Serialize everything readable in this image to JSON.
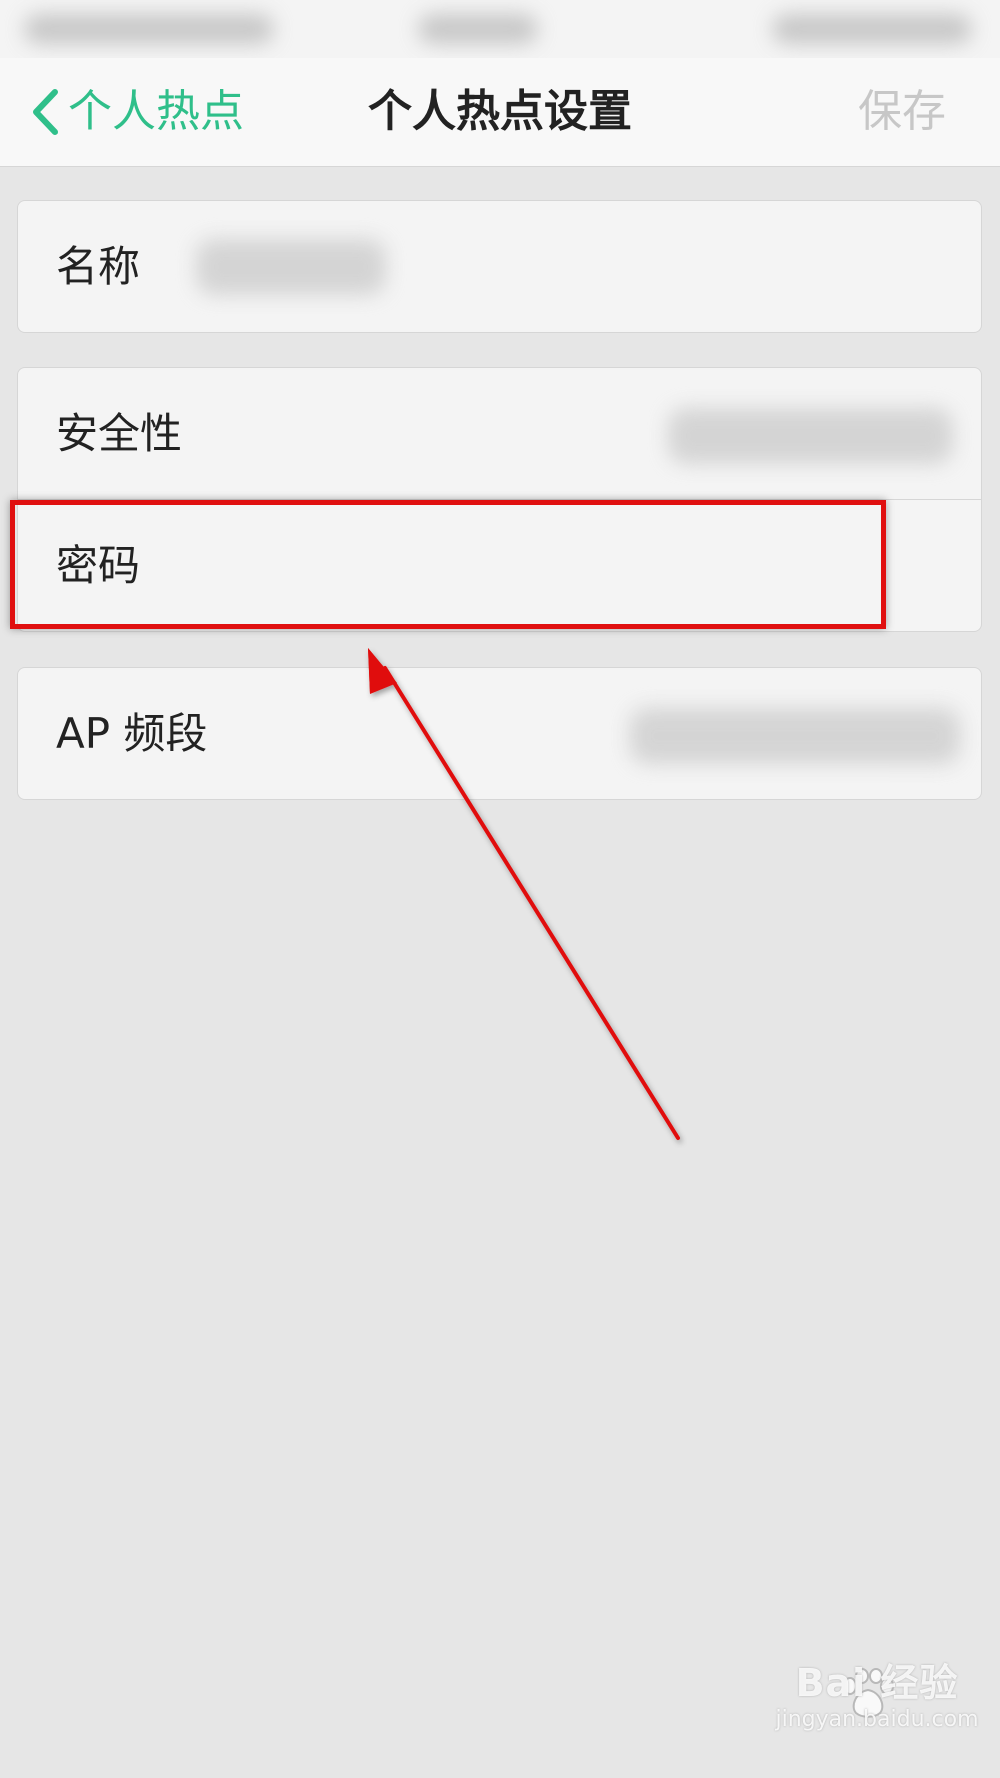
{
  "nav": {
    "back_label": "个人热点",
    "title": "个人热点设置",
    "save_label": "保存"
  },
  "settings": {
    "name_label": "名称",
    "security_label": "安全性",
    "password_label": "密码",
    "ap_band_label": "AP 频段"
  },
  "watermark": {
    "logo_text": "Bai 经验",
    "url": "jingyan.baidu.com"
  },
  "colors": {
    "accent": "#2fbf8a",
    "annotation": "#e01010",
    "background": "#e6e6e6"
  },
  "icons": {
    "back": "chevron-left-icon",
    "watermark_paw": "paw-icon"
  }
}
